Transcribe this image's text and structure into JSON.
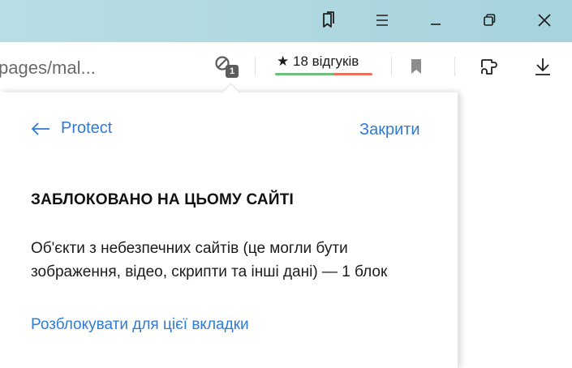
{
  "address_bar": {
    "url_text": "pages/mal..."
  },
  "protect": {
    "blocked_count": "1"
  },
  "reviews": {
    "star": "★",
    "label": "18 відгуків"
  },
  "panel": {
    "back_label": "Protect",
    "close_label": "Закрити",
    "heading": "ЗАБЛОКОВАНО НА ЦЬОМУ САЙТІ",
    "description": "Об'єкти з небезпечних сайтів (це могли бути зображення, відео, скрипти та інші дані) — 1 блок",
    "unblock_link": "Розблокувати для цієї вкладки"
  },
  "colors": {
    "link": "#2e7bd6",
    "titlebar": "#a6d3dc"
  }
}
